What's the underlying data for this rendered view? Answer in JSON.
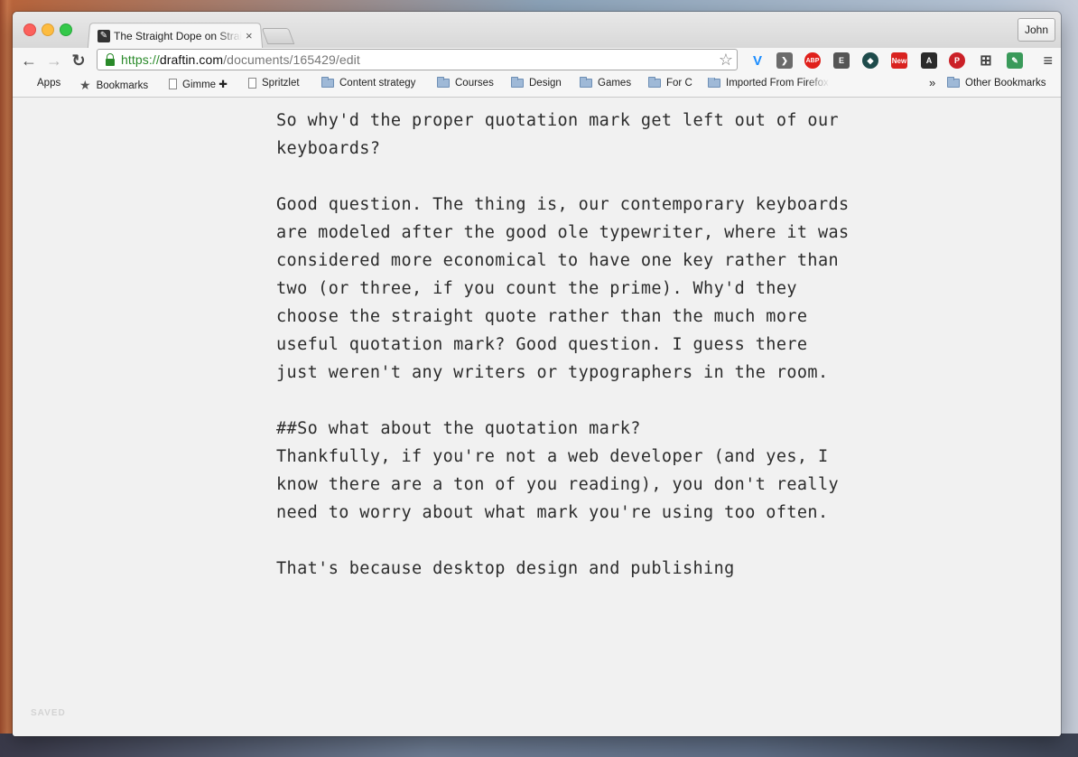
{
  "browser": {
    "tab_title": "The Straight Dope on Straight Quotes",
    "tab_close": "×",
    "profile_name": "John",
    "url": {
      "scheme": "https://",
      "host": "draftin.com",
      "path": "/documents/165429/edit"
    },
    "nav": {
      "back": "←",
      "forward": "→",
      "reload": "↻"
    },
    "star": "☆",
    "menu": "≡",
    "extensions": [
      {
        "name": "vimeo-icon",
        "label": "V",
        "color": "#1a8cff"
      },
      {
        "name": "pocket-icon",
        "label": "❯",
        "color": "#6b6b6b"
      },
      {
        "name": "adblock-icon",
        "label": "ABP",
        "color": "#e0201b"
      },
      {
        "name": "evernote-icon",
        "label": "E",
        "color": "#555555"
      },
      {
        "name": "feedly-icon",
        "label": "◆",
        "color": "#1e4b4b"
      },
      {
        "name": "news-icon",
        "label": "New",
        "color": "#d9221f"
      },
      {
        "name": "readability-icon",
        "label": "A",
        "color": "#2a2a2a"
      },
      {
        "name": "pinterest-icon",
        "label": "P",
        "color": "#cb2027"
      },
      {
        "name": "grid-icon",
        "label": "⊞",
        "color": "#444444"
      },
      {
        "name": "eyedropper-icon",
        "label": "✎",
        "color": "#3a9a5a"
      }
    ]
  },
  "bookmarks": {
    "items": [
      {
        "label": "Apps",
        "icon": "apps-grid-icon"
      },
      {
        "label": "Bookmarks",
        "icon": "star-icon"
      },
      {
        "label": "Gimme ✚",
        "icon": "page-icon"
      },
      {
        "label": "Spritzlet",
        "icon": "page-icon"
      },
      {
        "label": "Content strategy",
        "icon": "folder-icon"
      },
      {
        "label": "Courses",
        "icon": "folder-icon"
      },
      {
        "label": "Design",
        "icon": "folder-icon"
      },
      {
        "label": "Games",
        "icon": "folder-icon"
      },
      {
        "label": "For C",
        "icon": "folder-icon"
      },
      {
        "label": "Imported From Firefox",
        "icon": "folder-icon"
      }
    ],
    "overflow": "»",
    "other": "Other Bookmarks"
  },
  "document": {
    "paragraphs": [
      "So why'd the proper quotation mark get left out of our keyboards?",
      "Good question. The thing is, our contemporary keyboards are modeled after the good ole typewriter, where it was considered more economical to have one key rather than two (or three, if you count the prime). Why'd they choose the straight quote rather than the much more useful quotation mark? Good question. I guess there just weren't any writers or typographers in the room.",
      "##So what about the quotation mark?",
      "Thankfully, if you're not a web developer (and yes, I know there are a ton of you reading), you don't really need to worry about what mark you're using too often.",
      "That's because desktop design and publishing"
    ],
    "status": "SAVED"
  }
}
